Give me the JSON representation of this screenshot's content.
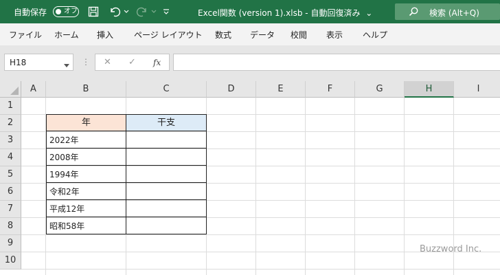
{
  "titlebar": {
    "autosave_label": "自動保存",
    "autosave_state": "オフ",
    "title": "Excel関数 (version 1).xlsb  -  自動回復済み",
    "title_caret": "⌄",
    "search_placeholder": "検索 (Alt+Q)",
    "icons": [
      "save-icon",
      "undo-icon",
      "redo-icon",
      "customize-qat-icon",
      "search-icon"
    ]
  },
  "menu": {
    "items": [
      "ファイル",
      "ホーム",
      "挿入",
      "ページ レイアウト",
      "数式",
      "データ",
      "校閲",
      "表示",
      "ヘルプ"
    ]
  },
  "formula_bar": {
    "name_box": "H18",
    "cancel_symbol": "✕",
    "enter_symbol": "✓",
    "fx_symbol": "fx",
    "formula_value": ""
  },
  "sheet": {
    "columns": [
      "A",
      "B",
      "C",
      "D",
      "E",
      "F",
      "G",
      "H",
      "I"
    ],
    "selected_column": "H",
    "rows": [
      "1",
      "2",
      "3",
      "4",
      "5",
      "6",
      "7",
      "8",
      "9",
      "10"
    ],
    "table": {
      "header_year": "年",
      "header_eto": "干支",
      "years": [
        "2022年",
        "2008年",
        "1994年",
        "令和2年",
        "平成12年",
        "昭和58年"
      ],
      "eto": [
        "",
        "",
        "",
        "",
        "",
        ""
      ]
    },
    "header_colors": {
      "year": "#fce4d6",
      "eto": "#ddebf7"
    }
  },
  "accent_color": "#217346",
  "watermark": "Buzzword Inc."
}
